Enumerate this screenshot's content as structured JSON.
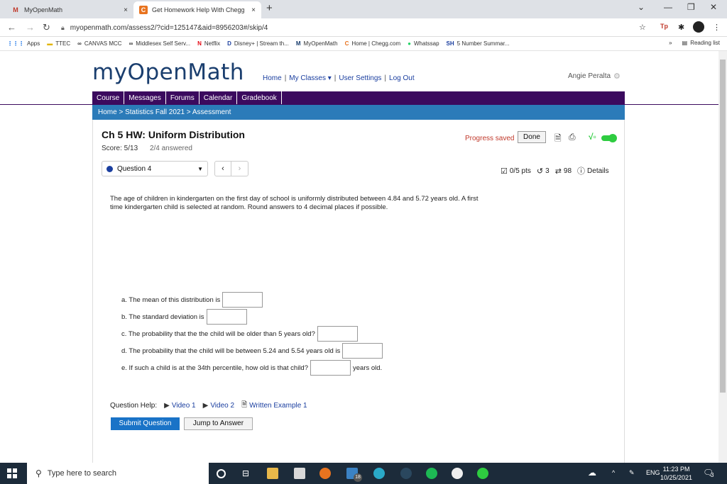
{
  "browser": {
    "tabs": [
      {
        "favicon": "M",
        "title": "MyOpenMath",
        "close": "×"
      },
      {
        "favicon": "C",
        "title": "Get Homework Help With Chegg",
        "close": "×"
      }
    ],
    "new_tab": "+",
    "url": "myopenmath.com/assess2/?cid=125147&aid=8956203#/skip/4",
    "bookmarks": [
      {
        "icon": "⋮⋮⋮",
        "label": "Apps"
      },
      {
        "icon": "▬",
        "label": "TTEC"
      },
      {
        "icon": "∞",
        "label": "CANVAS MCC"
      },
      {
        "icon": "∞",
        "label": "Middlesex Self Serv..."
      },
      {
        "icon": "N",
        "label": "Netflix"
      },
      {
        "icon": "D",
        "label": "Disney+ | Stream th..."
      },
      {
        "icon": "M",
        "label": "MyOpenMath"
      },
      {
        "icon": "C",
        "label": "Home | Chegg.com"
      },
      {
        "icon": "●",
        "label": "Whatssap"
      },
      {
        "icon": "SH",
        "label": "5 Number Summar..."
      }
    ],
    "bookmarks_more": "»",
    "reading_list": "Reading list"
  },
  "site": {
    "logo": "myOpenMath",
    "nav": {
      "home": "Home",
      "classes": "My Classes ▾",
      "settings": "User Settings",
      "logout": "Log Out"
    },
    "user": "Angie Peralta",
    "course_menu": [
      "Course",
      "Messages",
      "Forums",
      "Calendar",
      "Gradebook"
    ],
    "breadcrumb": {
      "home": "Home",
      "course": "Statistics Fall 2021",
      "current": "Assessment"
    }
  },
  "assessment": {
    "title": "Ch 5 HW: Uniform Distribution",
    "score": "Score: 5/13",
    "answered": "2/4 answered",
    "progress": "Progress saved",
    "done": "Done",
    "question_select": "Question 4",
    "prev": "‹",
    "next": "›",
    "pts": "0/5 pts",
    "retries": "3",
    "attempts": "98",
    "details": "Details"
  },
  "question": {
    "text": "The age of children in kindergarten on the first day of school is uniformly distributed between 4.84 and 5.72 years old. A first time kindergarten child is selected at random. Round answers to 4 decimal places if possible.",
    "parts": [
      {
        "label": "a. The mean of this distribution is",
        "after": ""
      },
      {
        "label": "b. The standard deviation is",
        "after": ""
      },
      {
        "label": "c. The probability that the the child will be older than 5 years old?",
        "after": ""
      },
      {
        "label": "d. The probability that the child will be between 5.24 and 5.54 years old is",
        "after": ""
      },
      {
        "label": "e. If such a child is at the 34th percentile, how old is that child?",
        "after": "years old."
      }
    ],
    "help_label": "Question Help:",
    "help_links": [
      "Video 1",
      "Video 2",
      "Written Example 1"
    ],
    "submit": "Submit Question",
    "jump": "Jump to Answer"
  },
  "taskbar": {
    "search_placeholder": "Type here to search",
    "badge": "18",
    "lang": "ENG",
    "time": "11:23 PM",
    "date": "10/25/2021",
    "notifications": "3"
  }
}
